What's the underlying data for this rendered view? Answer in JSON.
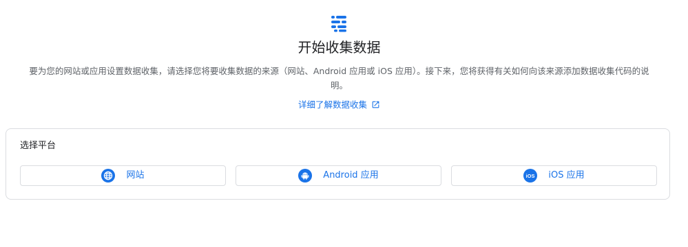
{
  "header": {
    "icon": "data-stream-icon",
    "title": "开始收集数据",
    "description": "要为您的网站或应用设置数据收集，请选择您将要收集数据的来源（网站、Android 应用或 iOS 应用）。接下来，您将获得有关如何向该来源添加数据收集代码的说明。",
    "learn_more_label": "详细了解数据收集",
    "learn_more_icon": "open-in-new-icon"
  },
  "platform_picker": {
    "title": "选择平台",
    "options": [
      {
        "label": "网站",
        "icon": "globe-icon"
      },
      {
        "label": "Android 应用",
        "icon": "android-icon"
      },
      {
        "label": "iOS 应用",
        "icon": "ios-icon"
      }
    ]
  },
  "colors": {
    "accent": "#1a73e8",
    "text_primary": "#202124",
    "text_secondary": "#5f6368",
    "border": "#dadce0"
  }
}
